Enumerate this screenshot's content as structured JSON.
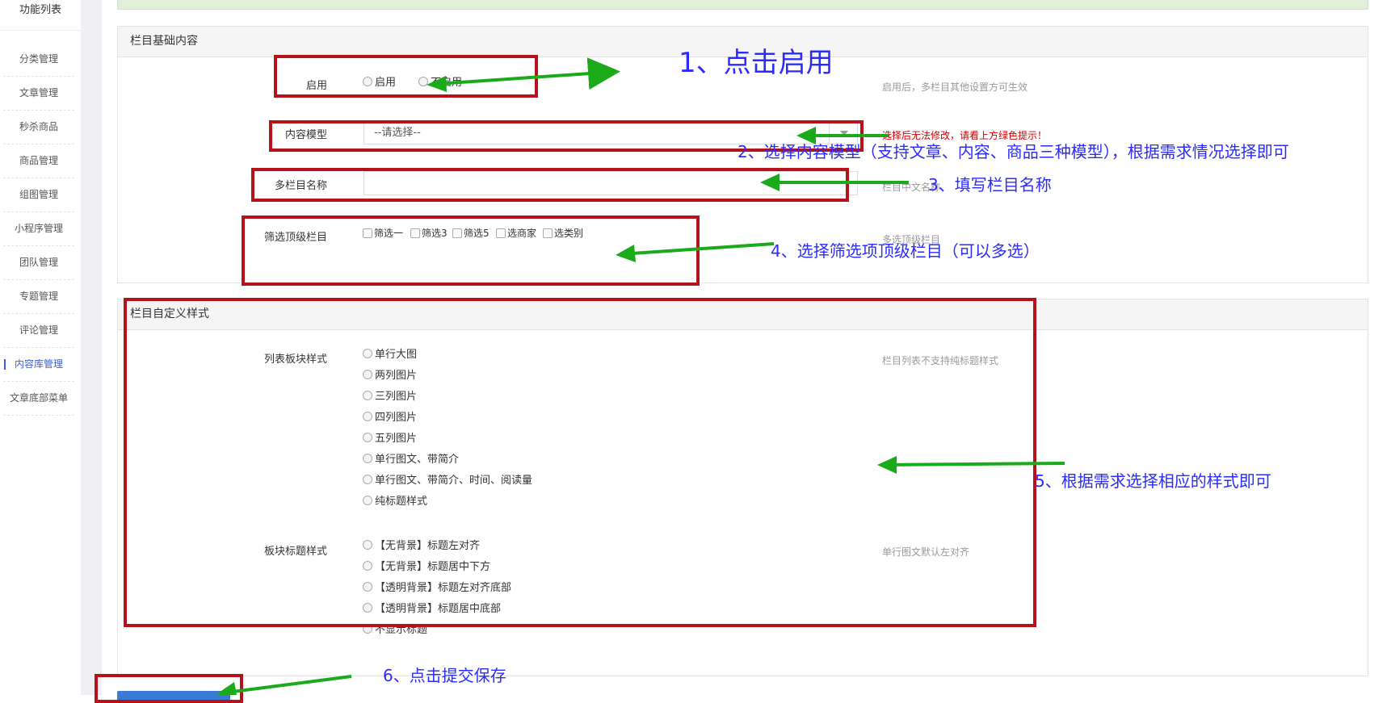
{
  "sidebar": {
    "title": "功能列表",
    "items": [
      {
        "label": "分类管理"
      },
      {
        "label": "文章管理"
      },
      {
        "label": "秒杀商品"
      },
      {
        "label": "商品管理"
      },
      {
        "label": "组图管理"
      },
      {
        "label": "小程序管理"
      },
      {
        "label": "团队管理"
      },
      {
        "label": "专题管理"
      },
      {
        "label": "评论管理"
      },
      {
        "label": "内容库管理",
        "active": true
      },
      {
        "label": "文章底部菜单"
      }
    ]
  },
  "basic_panel": {
    "title": "栏目基础内容",
    "enable": {
      "label": "启用",
      "options": [
        "启用",
        "不启用"
      ],
      "hint": "启用后，多栏目其他设置方可生效"
    },
    "content_model": {
      "label": "内容模型",
      "selected": "--请选择--",
      "hint": "选择后无法修改，请看上方绿色提示！"
    },
    "name": {
      "label": "多栏目名称",
      "value": "",
      "hint": "栏目中文名称"
    },
    "filter_top": {
      "label": "筛选顶级栏目",
      "options": [
        "筛选一",
        "筛选3",
        "筛选5",
        "选商家",
        "选类别"
      ],
      "hint": "多选顶级栏目"
    }
  },
  "style_panel": {
    "title": "栏目自定义样式",
    "list_style": {
      "label": "列表板块样式",
      "options": [
        "单行大图",
        "两列图片",
        "三列图片",
        "四列图片",
        "五列图片",
        "单行图文、带简介",
        "单行图文、带简介、时间、阅读量",
        "纯标题样式"
      ],
      "hint": "栏目列表不支持纯标题样式"
    },
    "title_style": {
      "label": "板块标题样式",
      "options": [
        "【无背景】标题左对齐",
        "【无背景】标题居中下方",
        "【透明背景】标题左对齐底部",
        "【透明背景】标题居中底部",
        "不显示标题"
      ],
      "hint": "单行图文默认左对齐"
    }
  },
  "annotations": {
    "a1": "1、点击启用",
    "a2": "2、选择内容模型（支持文章、内容、商品三种模型），根据需求情况选择即可",
    "a3": "3、填写栏目名称",
    "a4": "4、选择筛选项顶级栏目（可以多选）",
    "a5": "5、根据需求选择相应的样式即可",
    "a6": "6、点击提交保存"
  },
  "colors": {
    "annotation_box": "#b5121b",
    "annotation_arrow": "#1aaa1a",
    "annotation_text": "#2b2bff",
    "active_nav": "#3b5fd6"
  }
}
